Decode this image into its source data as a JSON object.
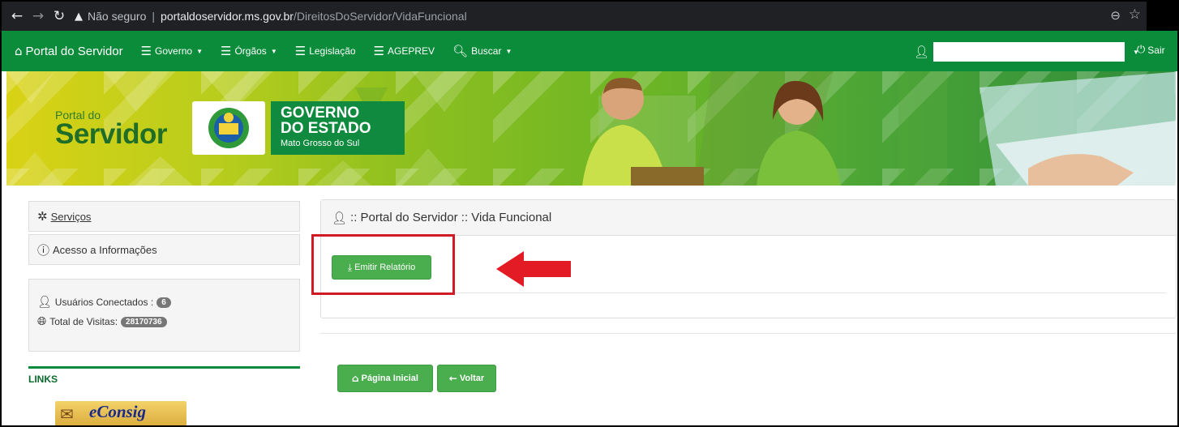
{
  "browser": {
    "back_icon": "arrow-left-icon",
    "forward_icon": "arrow-right-icon",
    "reload_icon": "reload-icon",
    "not_secure": "Não seguro",
    "separator": "|",
    "url_domain": "portaldoservidor.ms.gov.br",
    "url_path": "/DireitosDoServidor/VidaFuncional",
    "zoom_icon": "zoom-icon",
    "star_icon": "bookmark-star-icon"
  },
  "navbar": {
    "brand": "Portal do Servidor",
    "items": [
      {
        "label": "Governo",
        "icon": "menu-lines-icon",
        "dropdown": true
      },
      {
        "label": "Órgãos",
        "icon": "menu-lines-icon",
        "dropdown": true
      },
      {
        "label": "Legislação",
        "icon": "menu-lines-icon",
        "dropdown": false
      },
      {
        "label": "AGEPREV",
        "icon": "menu-lines-icon",
        "dropdown": false
      },
      {
        "label": "Buscar",
        "icon": "search-icon",
        "dropdown": true
      }
    ],
    "logout": "Sair",
    "color": "#0a8c3a"
  },
  "banner": {
    "logo_small": "Portal do",
    "logo_large": "Servidor",
    "gov_line1": "GOVERNO",
    "gov_line2": "DO ESTADO",
    "gov_line3": "Mato Grosso do Sul"
  },
  "sidebar": {
    "services": "Serviços",
    "access": "Acesso a Informações",
    "connected_label": "Usuários Conectados :",
    "connected_count": "6",
    "visits_label": "Total de Visitas:",
    "visits_count": "28170736",
    "links_title": "LINKS",
    "econsig": "eConsig"
  },
  "main": {
    "panel_title": ":: Portal do Servidor :: Vida Funcional",
    "report_button": "Emitir Relatório",
    "home_button": "Página Inicial",
    "back_button": "Voltar",
    "highlight_color": "#d11a23",
    "button_color": "#4aae4f"
  }
}
